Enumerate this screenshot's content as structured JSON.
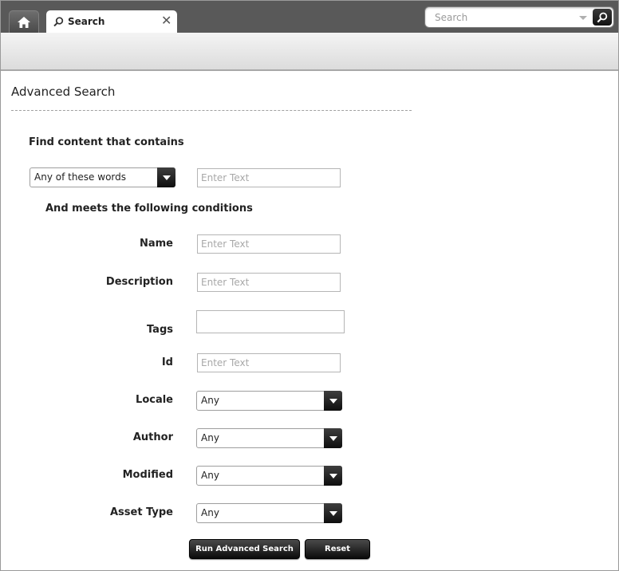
{
  "tabs": {
    "home_icon": "home-icon",
    "search_tab": {
      "label": "Search",
      "icon": "search-icon",
      "close": "✕"
    }
  },
  "global_search": {
    "placeholder": "Search"
  },
  "page": {
    "title": "Advanced Search"
  },
  "content_filter": {
    "heading": "Find content that contains",
    "match_mode": "Any of these words",
    "text_placeholder": "Enter Text"
  },
  "conditions": {
    "heading": "And meets the following conditions",
    "name": {
      "label": "Name",
      "placeholder": "Enter Text"
    },
    "description": {
      "label": "Description",
      "placeholder": "Enter Text"
    },
    "tags": {
      "label": "Tags",
      "value": ""
    },
    "id": {
      "label": "Id",
      "placeholder": "Enter Text"
    },
    "locale": {
      "label": "Locale",
      "value": "Any"
    },
    "author": {
      "label": "Author",
      "value": "Any"
    },
    "modified": {
      "label": "Modified",
      "value": "Any"
    },
    "asset_type": {
      "label": "Asset Type",
      "value": "Any"
    }
  },
  "actions": {
    "run_label": "Run Advanced Search",
    "reset_label": "Reset"
  }
}
